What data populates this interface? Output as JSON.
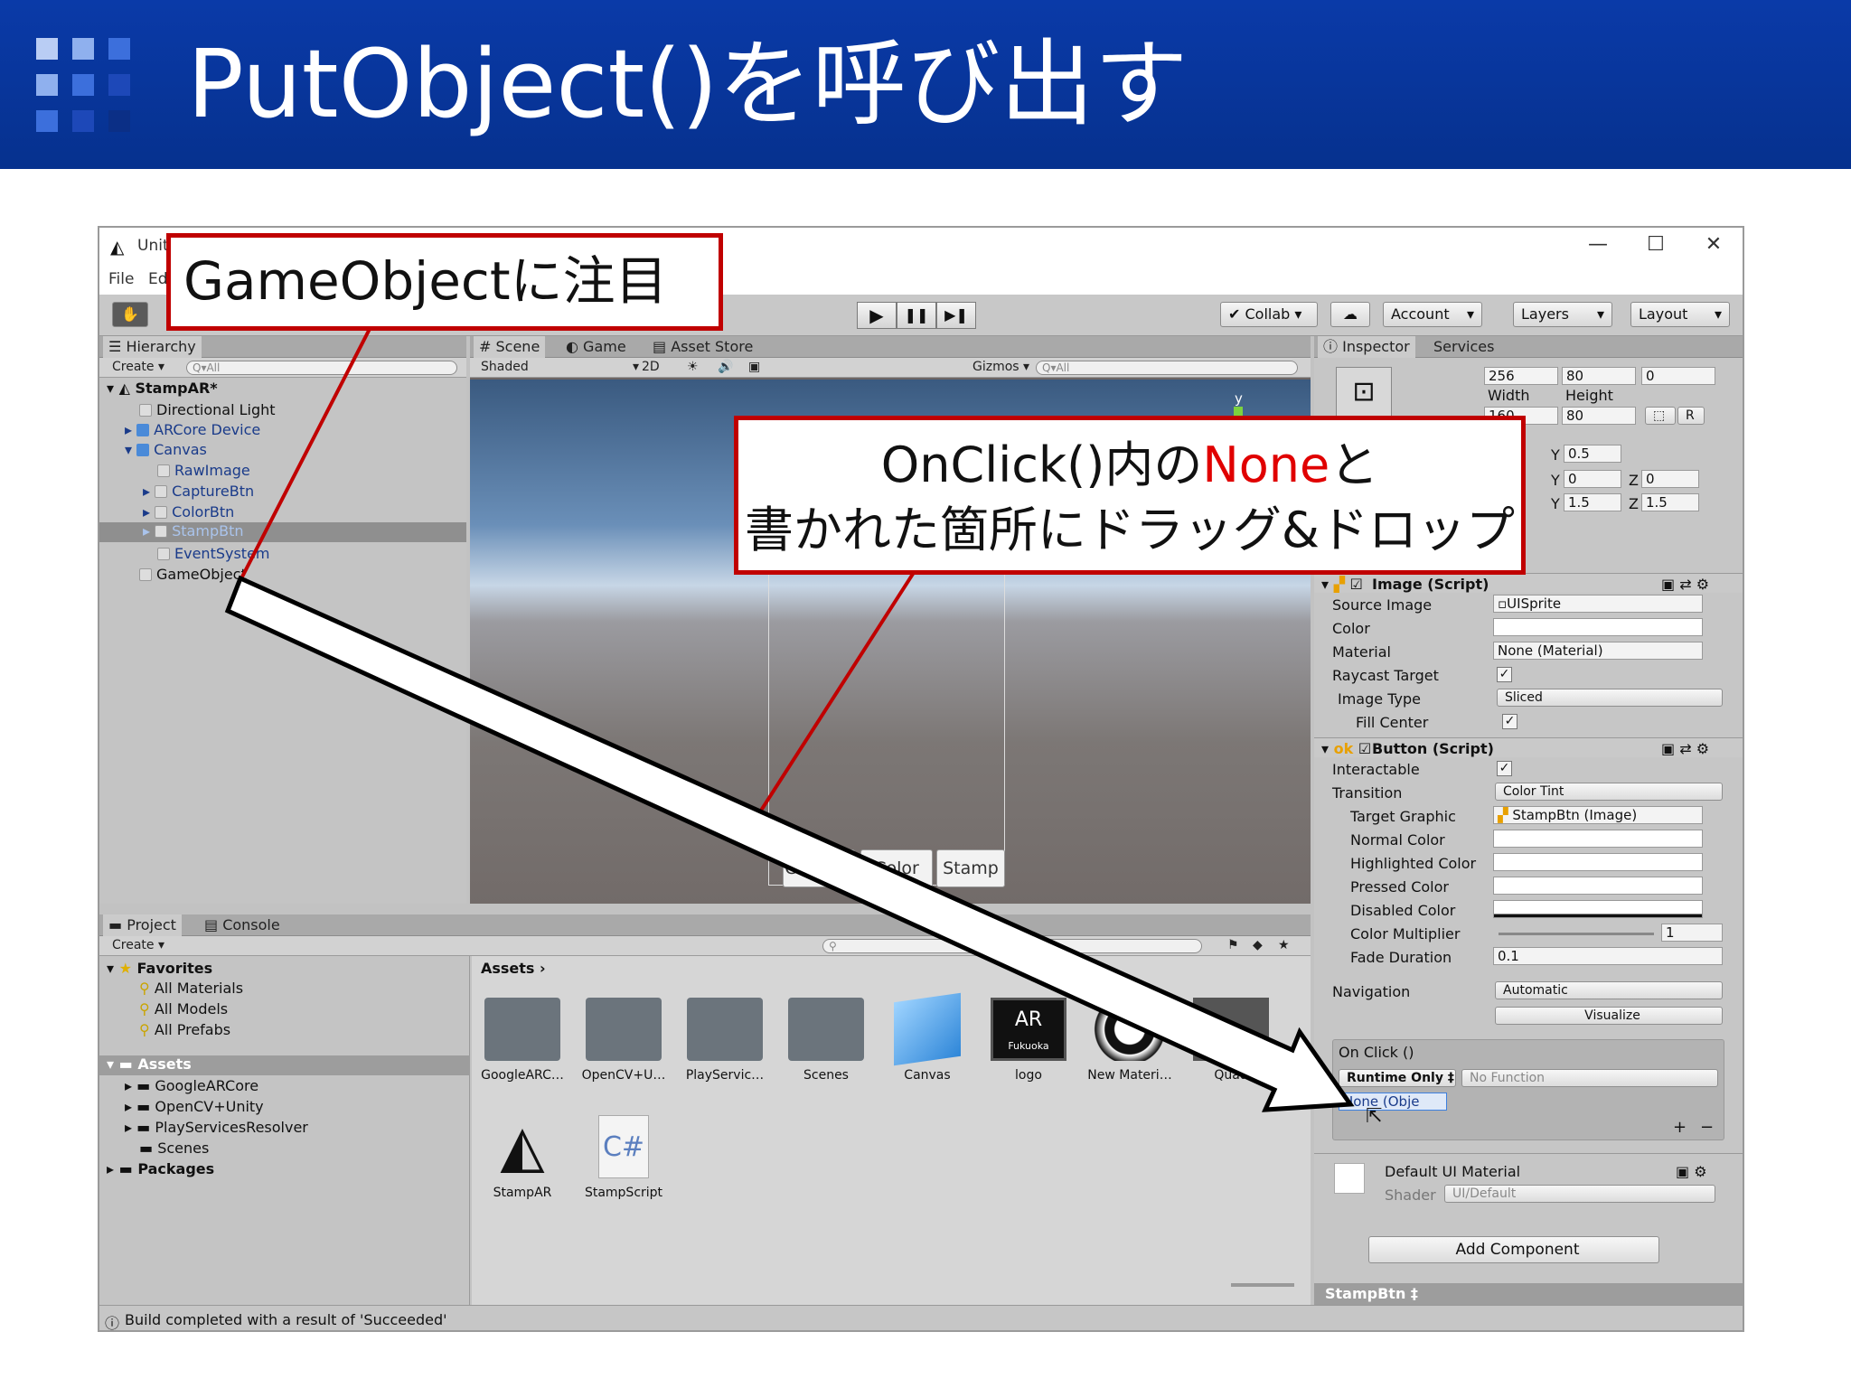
{
  "slide": {
    "title": "PutObject()を呼び出す"
  },
  "window": {
    "title": "Unit",
    "menu": [
      "File",
      "Ed"
    ],
    "min": "—",
    "max": "☐",
    "close": "✕"
  },
  "toolbar": {
    "collab": "Collab ▾",
    "account": "Account",
    "layers": "Layers",
    "layout": "Layout",
    "play": "▶",
    "pause": "❚❚",
    "step": "▶❚"
  },
  "hierarchy": {
    "tab": "Hierarchy",
    "create": "Create ▾",
    "search_placeholder": "Q▾All",
    "scene": "StampAR*",
    "items": [
      "Directional Light",
      "ARCore Device",
      "Canvas",
      "RawImage",
      "CaptureBtn",
      "ColorBtn",
      "StampBtn",
      "EventSystem",
      "GameObject"
    ]
  },
  "scene": {
    "tabs": [
      "Scene",
      "Game",
      "Asset Store"
    ],
    "shaded": "Shaded",
    "mode2d": "2D",
    "gizmos": "Gizmos ▾",
    "search_placeholder": "Q▾All",
    "axis": "y",
    "buttons": [
      "Capture",
      "Color",
      "Stamp"
    ]
  },
  "project": {
    "tabs": [
      "Project",
      "Console"
    ],
    "create": "Create ▾",
    "favorites": "Favorites",
    "favorite_items": [
      "All Materials",
      "All Models",
      "All Prefabs"
    ],
    "assets_root": "Assets",
    "asset_folders": [
      "GoogleARCore",
      "OpenCV+Unity",
      "PlayServicesResolver",
      "Scenes"
    ],
    "packages": "Packages",
    "breadcrumb": "Assets",
    "grid": [
      {
        "label": "GoogleARC…",
        "kind": "folder"
      },
      {
        "label": "OpenCV+U…",
        "kind": "folder"
      },
      {
        "label": "PlayServic…",
        "kind": "folder"
      },
      {
        "label": "Scenes",
        "kind": "folder"
      },
      {
        "label": "Canvas",
        "kind": "prefab"
      },
      {
        "label": "logo",
        "kind": "image"
      },
      {
        "label": "New Materi…",
        "kind": "material"
      },
      {
        "label": "Quad",
        "kind": "mesh"
      },
      {
        "label": "StampAR",
        "kind": "unity"
      },
      {
        "label": "StampScript",
        "kind": "script"
      }
    ],
    "logo_text": "AR",
    "logo_text2": "Fukuoka",
    "script_icon": "C#"
  },
  "inspector": {
    "tabs": [
      "Inspector",
      "Services"
    ],
    "rect": {
      "r1": [
        "256",
        "80",
        "0"
      ],
      "width_label": "Width",
      "height_label": "Height",
      "r2": [
        "160",
        "80"
      ],
      "r_btn": "R",
      "y1": "0.5",
      "y2": "0",
      "z2": "0",
      "y3": "1.5",
      "z3": "1.5",
      "y_label": "Y",
      "z_label": "Z"
    },
    "image_component": {
      "title": "Image (Script)",
      "source_image_label": "Source Image",
      "source_image": "UISprite",
      "color_label": "Color",
      "material_label": "Material",
      "material": "None (Material)",
      "raycast_label": "Raycast Target",
      "image_type_label": "Image Type",
      "image_type": "Sliced",
      "fill_center_label": "Fill Center"
    },
    "button_component": {
      "title": "Button (Script)",
      "interactable_label": "Interactable",
      "transition_label": "Transition",
      "transition": "Color Tint",
      "target_graphic_label": "Target Graphic",
      "target_graphic": "StampBtn (Image)",
      "normal_label": "Normal Color",
      "highlighted_label": "Highlighted Color",
      "pressed_label": "Pressed Color",
      "disabled_label": "Disabled Color",
      "multiplier_label": "Color Multiplier",
      "multiplier": "1",
      "fade_label": "Fade Duration",
      "fade": "0.1",
      "navigation_label": "Navigation",
      "navigation": "Automatic",
      "visualize": "Visualize",
      "onclick_label": "On Click ()",
      "runtime": "Runtime Only ‡",
      "function": "No Function",
      "none_object": "None (Obje",
      "plus": "+",
      "minus": "−"
    },
    "material": {
      "title": "Default UI Material",
      "shader_label": "Shader",
      "shader": "UI/Default"
    },
    "add_component": "Add Component",
    "footer": "StampBtn ‡"
  },
  "status": {
    "text": "Build completed with a result of 'Succeeded'"
  },
  "callouts": {
    "gameobject": "GameObjectに注目",
    "onclick_line1_a": "OnClick()内の",
    "onclick_line1_b": "None",
    "onclick_line1_c": "と",
    "onclick_line2": "書かれた箇所にドラッグ&ドロップ"
  },
  "colors": {
    "header_blue": "#0a3aa8",
    "callout_red": "#c00000",
    "highlight_red": "#e00000",
    "selection_blue": "#3d80df"
  }
}
